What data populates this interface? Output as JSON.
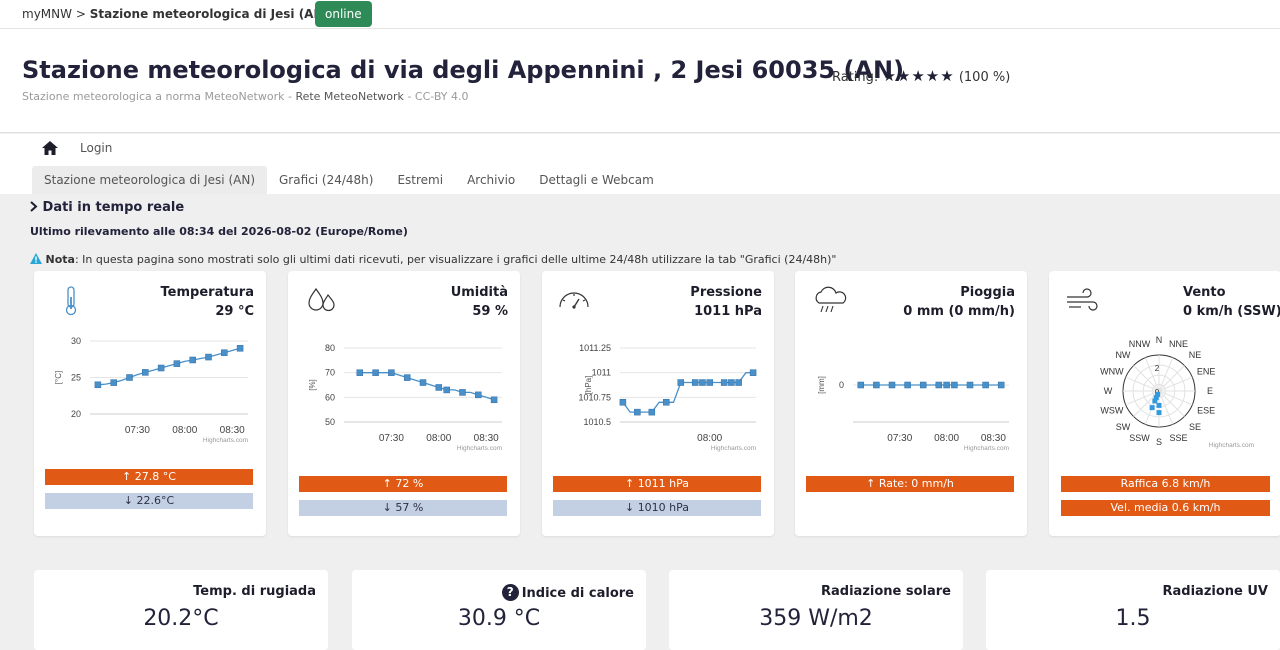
{
  "breadcrumb": {
    "root": "myMNW",
    "sep": ">",
    "station": "Stazione meteorologica di Jesi (AN)",
    "slash": "/",
    "status": "online"
  },
  "header": {
    "title": "Stazione meteorologica di via degli Appennini , 2 Jesi 60035 (AN)",
    "rating_label": "Rating:",
    "stars": "★★★★★",
    "rating_pct": "(100 %)",
    "subtitle_a": "Stazione meteorologica a norma MeteoNetwork -",
    "subtitle_b": "Rete MeteoNetwork",
    "subtitle_c": "- CC-BY 4.0"
  },
  "nav": {
    "login": "Login",
    "tabs": [
      "Stazione meteorologica di Jesi (AN)",
      "Grafici (24/48h)",
      "Estremi",
      "Archivio",
      "Dettagli e Webcam"
    ]
  },
  "realtime": {
    "heading": "Dati in tempo reale",
    "last_update": "Ultimo rilevamento alle 08:34 del 2026-08-02 (Europe/Rome)",
    "note_label": "Nota",
    "note_text": ": In questa pagina sono mostrati solo gli ultimi dati ricevuti, per visualizzare i grafici delle ultime 24/48h utilizzare la tab \"Grafici (24/48h)\""
  },
  "cards": [
    {
      "title": "Temperatura",
      "value": "29 °C",
      "icon": "thermometer-icon",
      "max": "27.8 °C",
      "min": "22.6°C"
    },
    {
      "title": "Umidità",
      "value": "59 %",
      "icon": "humidity-drops-icon",
      "max": "72 %",
      "min": "57 %"
    },
    {
      "title": "Pressione",
      "value": "1011 hPa",
      "icon": "barometer-gauge-icon",
      "max": "1011 hPa",
      "min": "1010 hPa"
    },
    {
      "title": "Pioggia",
      "value": "0 mm (0 mm/h)",
      "icon": "rain-cloud-icon",
      "max": "Rate: 0 mm/h"
    },
    {
      "title": "Vento",
      "value": "0 km/h (SSW)",
      "icon": "wind-icon",
      "gust": "Raffica 6.8 km/h",
      "avg": "Vel. media 0.6 km/h"
    }
  ],
  "small_cards": [
    {
      "title": "Temp. di rugiada",
      "value": "20.2°C"
    },
    {
      "title": "Indice di calore",
      "value": "30.9 °C",
      "help_icon": "?"
    },
    {
      "title": "Radiazione solare",
      "value": "359 W/m2"
    },
    {
      "title": "Radiazione UV",
      "value": "1.5"
    }
  ],
  "chart_credit": "Highcharts.com",
  "chart_data": [
    {
      "type": "line",
      "name": "Temperatura",
      "ylabel": "[°C]",
      "yticks": [
        20,
        25,
        30
      ],
      "ylim": [
        20,
        30
      ],
      "xticks": [
        "07:30",
        "08:00",
        "08:30"
      ],
      "x": [
        "07:05",
        "07:10",
        "07:15",
        "07:20",
        "07:25",
        "07:30",
        "07:35",
        "07:40",
        "07:45",
        "07:50",
        "07:55",
        "08:00",
        "08:05",
        "08:10",
        "08:15",
        "08:20",
        "08:25",
        "08:30",
        "08:35"
      ],
      "values": [
        24.0,
        24.1,
        24.3,
        24.6,
        25.0,
        25.4,
        25.7,
        26.0,
        26.3,
        26.6,
        26.9,
        27.2,
        27.4,
        27.6,
        27.8,
        28.1,
        28.4,
        28.7,
        29.0
      ],
      "markers": [
        0,
        2,
        4,
        6,
        8,
        10,
        12,
        14,
        16,
        18
      ],
      "color": "#4a90c8"
    },
    {
      "type": "line",
      "name": "Umidità",
      "ylabel": "[%]",
      "yticks": [
        50,
        60,
        70,
        80
      ],
      "ylim": [
        50,
        80
      ],
      "xticks": [
        "07:30",
        "08:00",
        "08:30"
      ],
      "x": [
        "07:10",
        "07:15",
        "07:20",
        "07:25",
        "07:30",
        "07:35",
        "07:40",
        "07:45",
        "07:50",
        "07:55",
        "08:00",
        "08:05",
        "08:10",
        "08:15",
        "08:20",
        "08:25",
        "08:30",
        "08:35"
      ],
      "values": [
        70,
        70,
        70,
        70,
        70,
        69,
        68,
        67,
        66,
        65,
        64,
        63,
        63,
        62,
        62,
        61,
        60,
        59
      ],
      "markers": [
        0,
        2,
        4,
        6,
        8,
        10,
        11,
        13,
        15,
        17
      ],
      "color": "#4a90c8"
    },
    {
      "type": "line",
      "name": "Pressione",
      "ylabel": "[hPa]",
      "yticks": [
        1010.5,
        1010.75,
        1011,
        1011.25
      ],
      "ylim": [
        1010.5,
        1011.25
      ],
      "xticks": [
        "08:00"
      ],
      "x": [
        "07:00",
        "07:05",
        "07:10",
        "07:15",
        "07:20",
        "07:25",
        "07:30",
        "07:35",
        "07:40",
        "07:45",
        "07:50",
        "07:55",
        "08:00",
        "08:05",
        "08:10",
        "08:15",
        "08:20",
        "08:25",
        "08:30"
      ],
      "values": [
        1010.7,
        1010.6,
        1010.6,
        1010.6,
        1010.6,
        1010.7,
        1010.7,
        1010.7,
        1010.9,
        1010.9,
        1010.9,
        1010.9,
        1010.9,
        1010.9,
        1010.9,
        1010.9,
        1010.9,
        1011,
        1011
      ],
      "markers": [
        0,
        2,
        4,
        6,
        8,
        10,
        11,
        12,
        14,
        15,
        16,
        18
      ],
      "color": "#4a90c8"
    },
    {
      "type": "line",
      "name": "Pioggia",
      "ylabel": "[mm]",
      "yticks": [
        0.0
      ],
      "ylim": [
        -1,
        1
      ],
      "xticks": [
        "07:30",
        "08:00",
        "08:30"
      ],
      "x": [
        "07:05",
        "07:10",
        "07:15",
        "07:20",
        "07:25",
        "07:30",
        "07:35",
        "07:40",
        "07:45",
        "07:50",
        "07:55",
        "08:00",
        "08:05",
        "08:10",
        "08:15",
        "08:20",
        "08:25",
        "08:30",
        "08:35"
      ],
      "values": [
        0,
        0,
        0,
        0,
        0,
        0,
        0,
        0,
        0,
        0,
        0,
        0,
        0,
        0,
        0,
        0,
        0,
        0,
        0
      ],
      "markers": [
        0,
        2,
        4,
        6,
        8,
        10,
        11,
        12,
        14,
        16,
        18
      ],
      "color": "#4a90c8"
    },
    {
      "type": "scatter",
      "name": "Vento",
      "subtype": "wind-rose",
      "directions": [
        "N",
        "NNE",
        "NE",
        "ENE",
        "E",
        "ESE",
        "SE",
        "SSE",
        "S",
        "SSW",
        "SW",
        "WSW",
        "W",
        "WNW",
        "NW",
        "NNW"
      ],
      "radial_ticks": [
        0,
        2
      ],
      "points": [
        {
          "direction": "SSW",
          "speed": 0.3
        },
        {
          "direction": "SSW",
          "speed": 0.6
        },
        {
          "direction": "SSW",
          "speed": 0.9
        },
        {
          "direction": "S",
          "speed": 1.2
        },
        {
          "direction": "SSW",
          "speed": 1.5
        },
        {
          "direction": "S",
          "speed": 1.8
        }
      ],
      "color": "#3399dd"
    }
  ]
}
